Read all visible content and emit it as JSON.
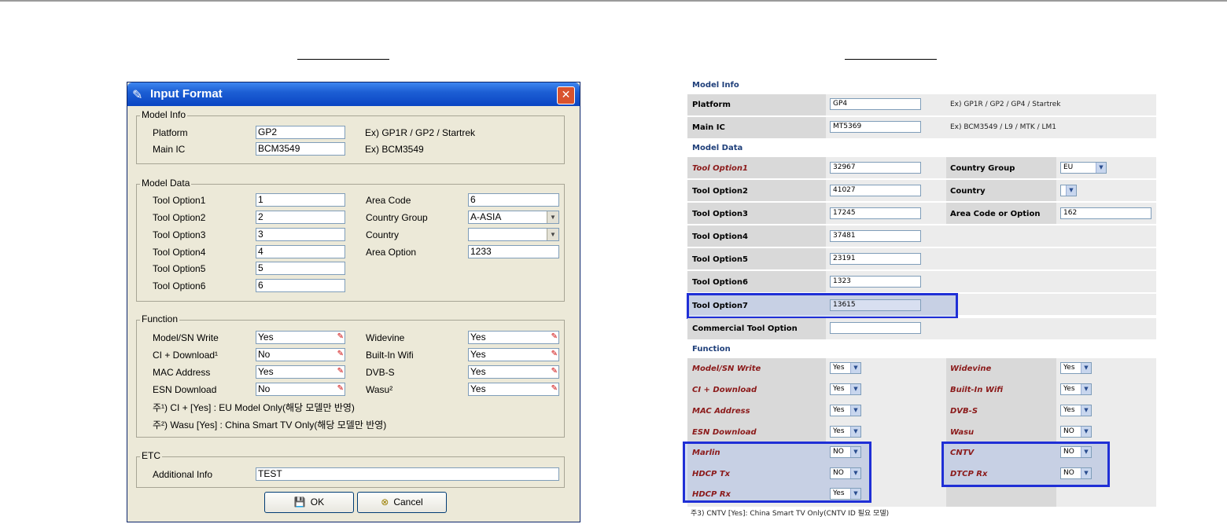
{
  "dialog": {
    "title": "Input Format",
    "model_info": {
      "legend": "Model Info",
      "platform_label": "Platform",
      "platform_value": "GP2",
      "platform_hint": "Ex) GP1R / GP2 / Startrek",
      "main_ic_label": "Main IC",
      "main_ic_value": "BCM3549",
      "main_ic_hint": "Ex) BCM3549"
    },
    "model_data": {
      "legend": "Model Data",
      "tool_options": [
        {
          "label": "Tool Option1",
          "value": "1"
        },
        {
          "label": "Tool Option2",
          "value": "2"
        },
        {
          "label": "Tool Option3",
          "value": "3"
        },
        {
          "label": "Tool Option4",
          "value": "4"
        },
        {
          "label": "Tool Option5",
          "value": "5"
        },
        {
          "label": "Tool Option6",
          "value": "6"
        }
      ],
      "area_code_label": "Area Code",
      "area_code_value": "6",
      "country_group_label": "Country Group",
      "country_group_value": "A-ASIA",
      "country_label": "Country",
      "country_value": "",
      "area_option_label": "Area Option",
      "area_option_value": "1233"
    },
    "function": {
      "legend": "Function",
      "left": [
        {
          "label": "Model/SN Write",
          "value": "Yes"
        },
        {
          "label": "CI + Download¹",
          "value": "No"
        },
        {
          "label": "MAC Address",
          "value": "Yes"
        },
        {
          "label": "ESN Download",
          "value": "No"
        }
      ],
      "right": [
        {
          "label": "Widevine",
          "value": "Yes"
        },
        {
          "label": "Built-In Wifi",
          "value": "Yes"
        },
        {
          "label": "DVB-S",
          "value": "Yes"
        },
        {
          "label": "Wasu²",
          "value": "Yes"
        }
      ],
      "note1": "주¹) CI + [Yes] : EU Model Only(해당 모델만 반영)",
      "note2": "주²) Wasu [Yes] : China Smart TV Only(해당 모델만 반영)"
    },
    "etc": {
      "legend": "ETC",
      "additional_info_label": "Additional Info",
      "additional_info_value": "TEST"
    },
    "ok_label": "OK",
    "cancel_label": "Cancel"
  },
  "web": {
    "model_info_header": "Model Info",
    "platform_label": "Platform",
    "platform_value": "GP4",
    "platform_hint": "Ex) GP1R / GP2 / GP4 / Startrek",
    "main_ic_label": "Main IC",
    "main_ic_value": "MT5369",
    "main_ic_hint": "Ex) BCM3549 / L9 / MTK / LM1",
    "model_data_header": "Model Data",
    "tool_options": [
      {
        "label": "Tool Option1",
        "value": "32967"
      },
      {
        "label": "Tool Option2",
        "value": "41027"
      },
      {
        "label": "Tool Option3",
        "value": "17245"
      },
      {
        "label": "Tool Option4",
        "value": "37481"
      },
      {
        "label": "Tool Option5",
        "value": "23191"
      },
      {
        "label": "Tool Option6",
        "value": "1323"
      },
      {
        "label": "Tool Option7",
        "value": "13615"
      }
    ],
    "commercial_label": "Commercial Tool Option",
    "commercial_value": "",
    "country_group_label": "Country Group",
    "country_group_value": "EU",
    "country_label": "Country",
    "country_value": "",
    "area_label": "Area Code or Option",
    "area_value": "162",
    "function_header": "Function",
    "functions_left": [
      {
        "label": "Model/SN Write",
        "value": "Yes"
      },
      {
        "label": "CI + Download",
        "value": "Yes"
      },
      {
        "label": "MAC Address",
        "value": "Yes"
      },
      {
        "label": "ESN Download",
        "value": "Yes"
      },
      {
        "label": "Marlin",
        "value": "NO"
      },
      {
        "label": "HDCP Tx",
        "value": "NO"
      },
      {
        "label": "HDCP Rx",
        "value": "Yes"
      }
    ],
    "functions_right": [
      {
        "label": "Widevine",
        "value": "Yes"
      },
      {
        "label": "Built-In Wifi",
        "value": "Yes"
      },
      {
        "label": "DVB-S",
        "value": "Yes"
      },
      {
        "label": "Wasu",
        "value": "NO"
      },
      {
        "label": "CNTV",
        "value": "NO"
      },
      {
        "label": "DTCP Rx",
        "value": "NO"
      }
    ],
    "footnote": "주3) CNTV [Yes]: China Smart TV Only(CNTV ID 필요 모델)"
  },
  "colors": {
    "highlight_border": "#1f2fd6",
    "label_red": "#8b1a1a",
    "header_blue": "#1f3f7a"
  }
}
